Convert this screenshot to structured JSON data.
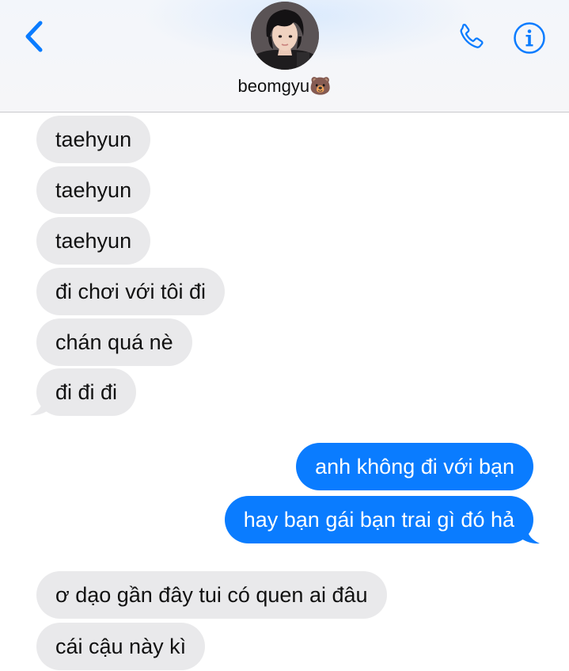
{
  "header": {
    "contact_name": "beomgyu🐻",
    "back_icon": "chevron-left-icon",
    "call_icon": "phone-icon",
    "info_icon": "info-icon",
    "accent_color": "#0a7cff"
  },
  "messages": [
    {
      "direction": "incoming",
      "text": "taehyun"
    },
    {
      "direction": "incoming",
      "text": "taehyun"
    },
    {
      "direction": "incoming",
      "text": "taehyun"
    },
    {
      "direction": "incoming",
      "text": "đi chơi với tôi đi"
    },
    {
      "direction": "incoming",
      "text": "chán quá nè"
    },
    {
      "direction": "incoming",
      "text": "đi đi đi"
    },
    {
      "direction": "outgoing",
      "text": "anh không đi với bạn"
    },
    {
      "direction": "outgoing",
      "text": "hay bạn gái bạn trai gì đó hả"
    },
    {
      "direction": "incoming",
      "text": "ơ dạo gần đây tui có quen ai đâu"
    },
    {
      "direction": "incoming",
      "text": "cái cậu này kì"
    }
  ],
  "colors": {
    "incoming_bubble": "#e9e9eb",
    "outgoing_bubble": "#0a7cff"
  }
}
